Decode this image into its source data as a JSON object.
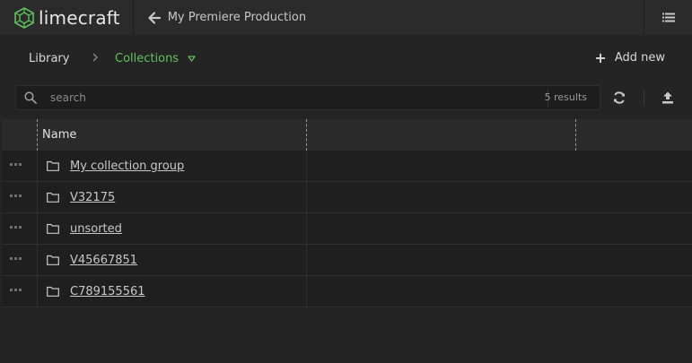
{
  "app": {
    "logo_text": "limecraft",
    "project_title": "My Premiere Production"
  },
  "breadcrumb": {
    "library": "Library",
    "current": "Collections"
  },
  "toolbar": {
    "add_new_label": "Add new",
    "add_new_icon": "plus-icon",
    "refresh_icon": "refresh-icon",
    "upload_icon": "upload-icon"
  },
  "search": {
    "placeholder": "search",
    "value": "",
    "results_text": "5 results"
  },
  "table": {
    "columns": [
      "Name",
      "",
      ""
    ],
    "rows": [
      {
        "name": "My collection group"
      },
      {
        "name": "V32175"
      },
      {
        "name": "unsorted"
      },
      {
        "name": "V45667851"
      },
      {
        "name": "C789155561"
      }
    ]
  },
  "colors": {
    "accent": "#5fc15c",
    "background": "#242424",
    "topbar": "#2b2b2b"
  }
}
